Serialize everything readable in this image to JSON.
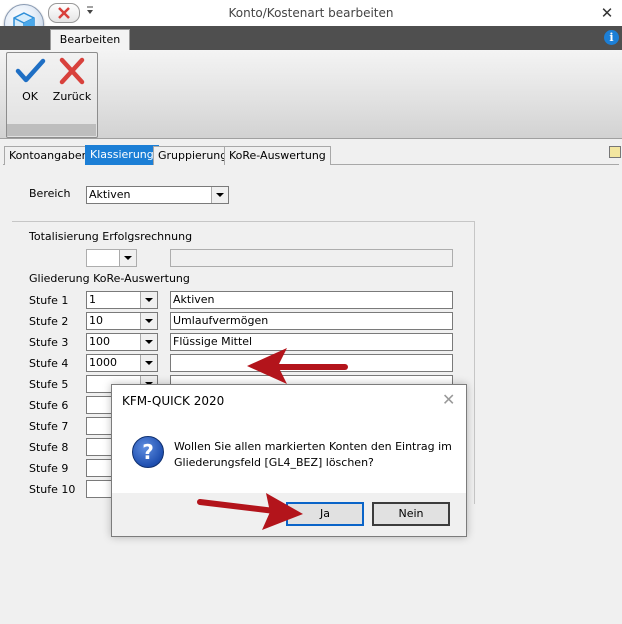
{
  "window": {
    "title": "Konto/Kostenart bearbeiten",
    "close_glyph": "✕"
  },
  "ribbon": {
    "tab": "Bearbeiten",
    "info_glyph": "i",
    "ok_label": "OK",
    "back_label": "Zurück"
  },
  "tabs": [
    "Kontoangaben",
    "Klassierung",
    "Gruppierung",
    "KoRe-Auswertung"
  ],
  "active_tab": "Klassierung",
  "form": {
    "bereich_label": "Bereich",
    "bereich_value": "Aktiven",
    "totalisierung_label": "Totalisierung Erfolgsrechnung",
    "gliederung_label": "Gliederung KoRe-Auswertung",
    "stufen": [
      {
        "label": "Stufe 1",
        "code": "1",
        "text": "Aktiven"
      },
      {
        "label": "Stufe 2",
        "code": "10",
        "text": "Umlaufvermögen"
      },
      {
        "label": "Stufe 3",
        "code": "100",
        "text": "Flüssige Mittel"
      },
      {
        "label": "Stufe 4",
        "code": "1000",
        "text": ""
      },
      {
        "label": "Stufe 5",
        "code": "",
        "text": ""
      },
      {
        "label": "Stufe 6",
        "code": "",
        "text": ""
      },
      {
        "label": "Stufe 7",
        "code": "",
        "text": ""
      },
      {
        "label": "Stufe 8",
        "code": "",
        "text": ""
      },
      {
        "label": "Stufe 9",
        "code": "",
        "text": ""
      },
      {
        "label": "Stufe 10",
        "code": "",
        "text": ""
      }
    ]
  },
  "dialog": {
    "title": "KFM-QUICK  2020",
    "close_glyph": "✕",
    "icon_glyph": "?",
    "message": "Wollen Sie allen markierten Konten den Eintrag im Gliederungsfeld [GL4_BEZ] löschen?",
    "yes_label": "Ja",
    "no_label": "Nein"
  },
  "colors": {
    "accent": "#1c7fd6",
    "ok_check": "#1f6fc4",
    "cancel_x": "#d8413c",
    "annotation_arrow": "#b3141b"
  },
  "icons": {
    "app": "app-orb-icon",
    "ok": "checkmark-icon",
    "back": "red-x-icon",
    "info": "info-icon",
    "question": "question-icon"
  }
}
